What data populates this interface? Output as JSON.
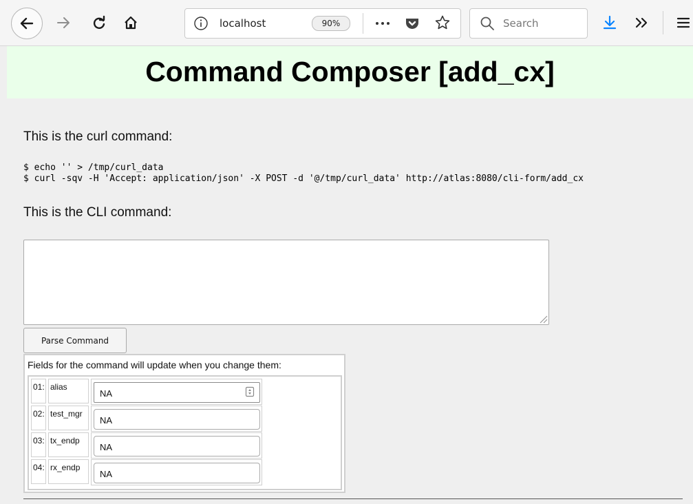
{
  "browser": {
    "url": "localhost",
    "zoom": "90%",
    "search_placeholder": "Search"
  },
  "page": {
    "title": "Command Composer [add_cx]",
    "curl_label": "This is the curl command:",
    "curl_lines": [
      "$ echo '' > /tmp/curl_data",
      "$ curl -sqv -H 'Accept: application/json' -X POST -d '@/tmp/curl_data' http://atlas:8080/cli-form/add_cx"
    ],
    "cli_label": "This is the CLI command:",
    "cli_value": "",
    "parse_button": "Parse Command",
    "fields_caption": "Fields for the command will update when you change them:",
    "fields": [
      {
        "num": "01:",
        "name": "alias",
        "value": "NA"
      },
      {
        "num": "02:",
        "name": "test_mgr",
        "value": "NA"
      },
      {
        "num": "03:",
        "name": "tx_endp",
        "value": "NA"
      },
      {
        "num": "04:",
        "name": "rx_endp",
        "value": "NA"
      }
    ]
  },
  "icons": {
    "back": "arrow-left-icon",
    "forward": "arrow-right-icon",
    "reload": "reload-icon",
    "home": "home-icon",
    "info": "info-icon",
    "more": "ellipsis-icon",
    "pocket": "pocket-icon",
    "bookmark": "star-icon",
    "search": "search-icon",
    "download": "download-icon",
    "overflow": "chevron-double-right-icon",
    "menu": "hamburger-icon"
  },
  "colors": {
    "header_bg": "#eaffea",
    "download_accent": "#0a84ff"
  }
}
